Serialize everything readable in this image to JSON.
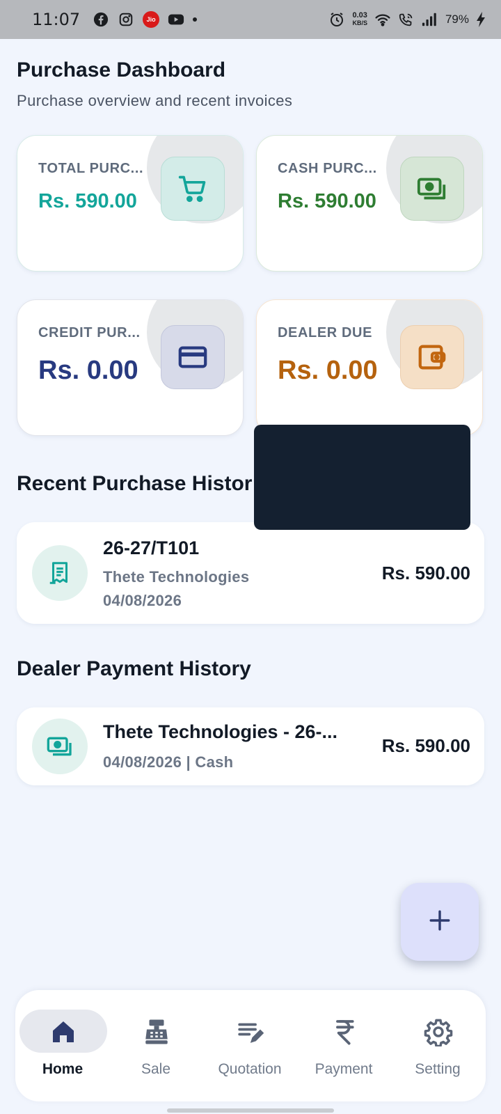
{
  "status_bar": {
    "time": "11:07",
    "left_icons": [
      "facebook-icon",
      "instagram-icon",
      "jio-icon",
      "youtube-icon",
      "notification-dot"
    ],
    "jio_label": "Jio",
    "net_speed_value": "0.03",
    "net_speed_unit": "KB/S",
    "battery": "79%"
  },
  "header": {
    "title": "Purchase Dashboard",
    "subtitle": "Purchase overview and recent invoices"
  },
  "stats": [
    {
      "label": "TOTAL PURC...",
      "value": "Rs. 590.00",
      "icon": "cart-icon",
      "value_color": "#13a59a",
      "icon_bg": "#d3ece8",
      "icon_color": "#13a59a"
    },
    {
      "label": "CASH PURC...",
      "value": "Rs. 590.00",
      "icon": "cash-icon",
      "value_color": "#2e7d32",
      "icon_bg": "#d6e6d6",
      "icon_color": "#2e7d32"
    },
    {
      "label": "CREDIT PUR...",
      "value": "Rs. 0.00",
      "icon": "credit-card-icon",
      "value_color": "#283a80",
      "icon_bg": "#d7dae9",
      "icon_color": "#283a80"
    },
    {
      "label": "DEALER DUE",
      "value": "Rs. 0.00",
      "icon": "wallet-icon",
      "value_color": "#b5620e",
      "icon_bg": "#f5dfc6",
      "icon_color": "#c2660f"
    }
  ],
  "recent_purchase": {
    "title": "Recent Purchase Histor",
    "items": [
      {
        "invoice": "26-27/T101",
        "dealer": "Thete Technologies",
        "date": "04/08/2026",
        "amount": "Rs. 590.00",
        "icon": "receipt-icon"
      }
    ]
  },
  "dealer_payment": {
    "title": "Dealer Payment History",
    "items": [
      {
        "title": "Thete Technologies - 26-...",
        "meta": "04/08/2026 | Cash",
        "amount": "Rs. 590.00",
        "icon": "cash-icon"
      }
    ]
  },
  "fab": {
    "icon": "plus-icon",
    "label": "+"
  },
  "nav": [
    {
      "label": "Home",
      "icon": "home-icon",
      "active": true
    },
    {
      "label": "Sale",
      "icon": "cash-register-icon",
      "active": false
    },
    {
      "label": "Quotation",
      "icon": "edit-note-icon",
      "active": false
    },
    {
      "label": "Payment",
      "icon": "rupee-icon",
      "active": false
    },
    {
      "label": "Setting",
      "icon": "gear-icon",
      "active": false
    }
  ],
  "colors": {
    "background": "#f1f5fd",
    "nav_active": "#2e3b6e",
    "nav_inactive": "#717b8b",
    "accent_teal": "#13a59a"
  }
}
